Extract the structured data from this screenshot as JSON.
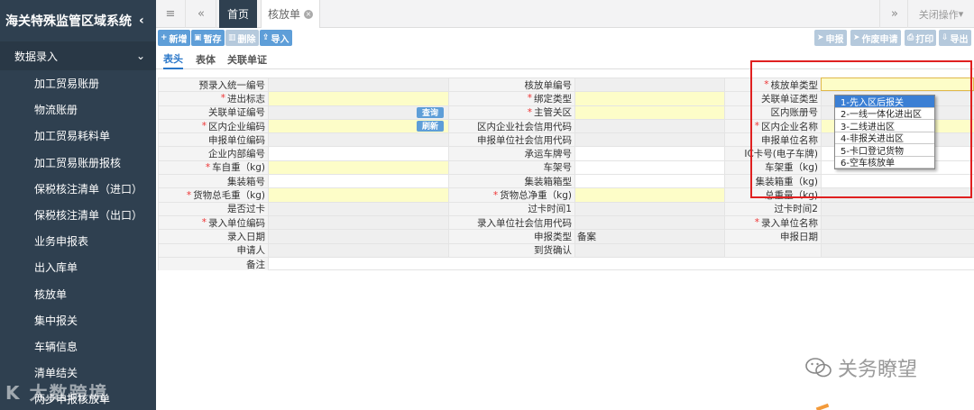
{
  "sidebar": {
    "system_title": "海关特殊监管区域系统",
    "group_label": "数据录入",
    "items": [
      {
        "label": "加工贸易账册"
      },
      {
        "label": "物流账册"
      },
      {
        "label": "加工贸易耗料单"
      },
      {
        "label": "加工贸易账册报核"
      },
      {
        "label": "保税核注清单（进口）"
      },
      {
        "label": "保税核注清单（出口）"
      },
      {
        "label": "业务申报表"
      },
      {
        "label": "出入库单"
      },
      {
        "label": "核放单"
      },
      {
        "label": "集中报关"
      },
      {
        "label": "车辆信息"
      },
      {
        "label": "清单结关"
      },
      {
        "label": "两步申报核放单"
      }
    ],
    "watermark": "大数跨境"
  },
  "topbar": {
    "home_tab": "首页",
    "active_tab": "核放单",
    "close_ops": "关闭操作"
  },
  "toolbar": {
    "add": "新增",
    "save": "暂存",
    "delete": "删除",
    "import": "导入",
    "declare": "申报",
    "void_apply": "作废申请",
    "print": "打印",
    "export": "导出"
  },
  "subtabs": [
    "表头",
    "表体",
    "关联单证"
  ],
  "form": {
    "rows": [
      {
        "c1": {
          "label": "预录入统一编号",
          "req": false,
          "style": "ro"
        },
        "c2": {
          "label": "核放单编号",
          "req": false,
          "style": "ro"
        },
        "c3": {
          "label": "核放单类型",
          "req": true,
          "style": "req"
        }
      },
      {
        "c1": {
          "label": "进出标志",
          "req": true,
          "style": "req"
        },
        "c2": {
          "label": "绑定类型",
          "req": true,
          "style": "req"
        },
        "c3": {
          "label": "关联单证类型",
          "req": false,
          "style": "ro"
        }
      },
      {
        "c1": {
          "label": "关联单证编号",
          "req": false,
          "style": "ro",
          "button": "查询"
        },
        "c2": {
          "label": "主管关区",
          "req": true,
          "style": "req"
        },
        "c3": {
          "label": "区内账册号",
          "req": false,
          "style": "ro"
        }
      },
      {
        "c1": {
          "label": "区内企业编码",
          "req": true,
          "style": "req",
          "button": "刷新"
        },
        "c2": {
          "label": "区内企业社会信用代码",
          "req": false,
          "style": "ro"
        },
        "c3": {
          "label": "区内企业名称",
          "req": true,
          "style": "req"
        }
      },
      {
        "c1": {
          "label": "申报单位编码",
          "req": false,
          "style": "ro"
        },
        "c2": {
          "label": "申报单位社会信用代码",
          "req": false,
          "style": "ro"
        },
        "c3": {
          "label": "申报单位名称",
          "req": false,
          "style": "ro"
        }
      },
      {
        "c1": {
          "label": "企业内部编号",
          "req": false,
          "style": "plain"
        },
        "c2": {
          "label": "承运车牌号",
          "req": false,
          "style": "plain"
        },
        "c3": {
          "label": "IC卡号(电子车牌)",
          "req": false,
          "style": "plain"
        }
      },
      {
        "c1": {
          "label": "车自重（kg)",
          "req": true,
          "style": "req"
        },
        "c2": {
          "label": "车架号",
          "req": false,
          "style": "plain"
        },
        "c3": {
          "label": "车架重（kg)",
          "req": false,
          "style": "plain"
        }
      },
      {
        "c1": {
          "label": "集装箱号",
          "req": false,
          "style": "plain"
        },
        "c2": {
          "label": "集装箱箱型",
          "req": false,
          "style": "plain"
        },
        "c3": {
          "label": "集装箱重（kg)",
          "req": false,
          "style": "plain"
        }
      },
      {
        "c1": {
          "label": "货物总毛重（kg)",
          "req": true,
          "style": "req"
        },
        "c2": {
          "label": "货物总净重（kg)",
          "req": true,
          "style": "req"
        },
        "c3": {
          "label": "总重量（kg)",
          "req": false,
          "style": "ro"
        }
      },
      {
        "c1": {
          "label": "是否过卡",
          "req": false,
          "style": "ro"
        },
        "c2": {
          "label": "过卡时间1",
          "req": false,
          "style": "ro"
        },
        "c3": {
          "label": "过卡时间2",
          "req": false,
          "style": "ro"
        }
      },
      {
        "c1": {
          "label": "录入单位编码",
          "req": true,
          "style": "ro"
        },
        "c2": {
          "label": "录入单位社会信用代码",
          "req": false,
          "style": "ro"
        },
        "c3": {
          "label": "录入单位名称",
          "req": true,
          "style": "ro"
        }
      },
      {
        "c1": {
          "label": "录入日期",
          "req": false,
          "style": "ro"
        },
        "c2": {
          "label": "申报类型",
          "req": false,
          "style": "ro",
          "value": "备案"
        },
        "c3": {
          "label": "申报日期",
          "req": false,
          "style": "ro"
        }
      },
      {
        "c1": {
          "label": "申请人",
          "req": false,
          "style": "ro"
        },
        "c2": {
          "label": "到货确认",
          "req": false,
          "style": "ro"
        },
        "c3": {
          "label": "",
          "req": false,
          "style": "ro"
        }
      }
    ],
    "remark_label": "备注"
  },
  "dropdown": {
    "options": [
      "1-先入区后报关",
      "2-一线一体化进出区",
      "3-二线进出区",
      "4-非报关进出区",
      "5-卡口登记货物",
      "6-空车核放单"
    ],
    "selected_index": 0
  },
  "watermark_right": "关务瞭望",
  "colors": {
    "sidebar": "#2f4050",
    "accent": "#5e9ed8",
    "required": "#fdfdc8",
    "highlight": "#e02020"
  }
}
